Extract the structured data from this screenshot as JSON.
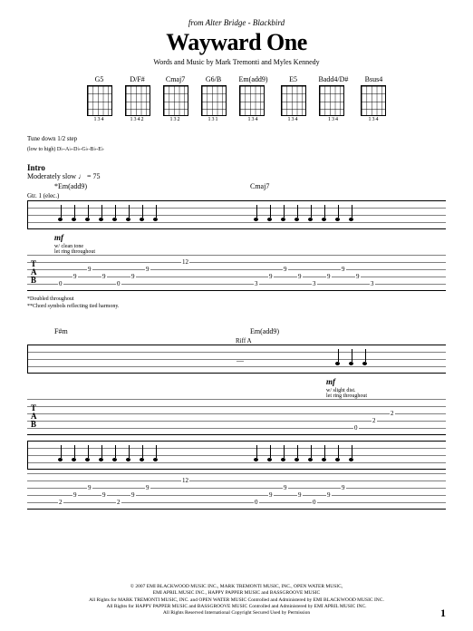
{
  "header": {
    "source": "from Alter Bridge - Blackbird",
    "title": "Wayward One",
    "credits": "Words and Music by Mark Tremonti and Myles Kennedy"
  },
  "chords": [
    {
      "name": "G5",
      "fingering": "134"
    },
    {
      "name": "D/F#",
      "fingering": "1342"
    },
    {
      "name": "Cmaj7",
      "fingering": "132"
    },
    {
      "name": "G6/B",
      "fingering": "131"
    },
    {
      "name": "Em(add9)",
      "fingering": "134"
    },
    {
      "name": "E5",
      "fingering": "134"
    },
    {
      "name": "Badd4/D#",
      "fingering": "134"
    },
    {
      "name": "Bsus4",
      "fingering": "134"
    }
  ],
  "tuning": {
    "note": "Tune down 1/2 step",
    "detail": "(low to high) D♭-A♭-D♭-G♭-B♭-E♭"
  },
  "intro": {
    "section": "Intro",
    "tempo": "Moderately slow ♩ = 75",
    "first_chord": "*Em(add9)",
    "second_chord": "Cmaj7",
    "gtr_label": "Gtr. 1 (elec.)",
    "dynamic": "mf",
    "technique1": "w/ clean tone",
    "technique2": "let ring throughout",
    "footnote1": "*Doubled throughout",
    "footnote2": "**Chord symbols reflecting tied harmony."
  },
  "system2": {
    "chord1": "F#m",
    "chord2": "Em(add9)",
    "riff_label": "Riff A",
    "dynamic": "mf",
    "technique1": "w/ slight dist.",
    "technique2": "let ring throughout"
  },
  "copyright": {
    "line1": "© 2007 EMI BLACKWOOD MUSIC INC., MARK TREMONTI MUSIC, INC., OPEN WATER MUSIC,",
    "line2": "EMI APRIL MUSIC INC., HAPPY PAPPER MUSIC and BASSGROOVE MUSIC",
    "line3": "All Rights for MARK TREMONTI MUSIC, INC. and OPEN WATER MUSIC Controlled and Administered by EMI BLACKWOOD MUSIC INC.",
    "line4": "All Rights for HAPPY PAPPER MUSIC and BASSGROOVE MUSIC Controlled and Administered by EMI APRIL MUSIC INC.",
    "line5": "All Rights Reserved   International Copyright Secured   Used by Permission"
  },
  "page_number": "1"
}
